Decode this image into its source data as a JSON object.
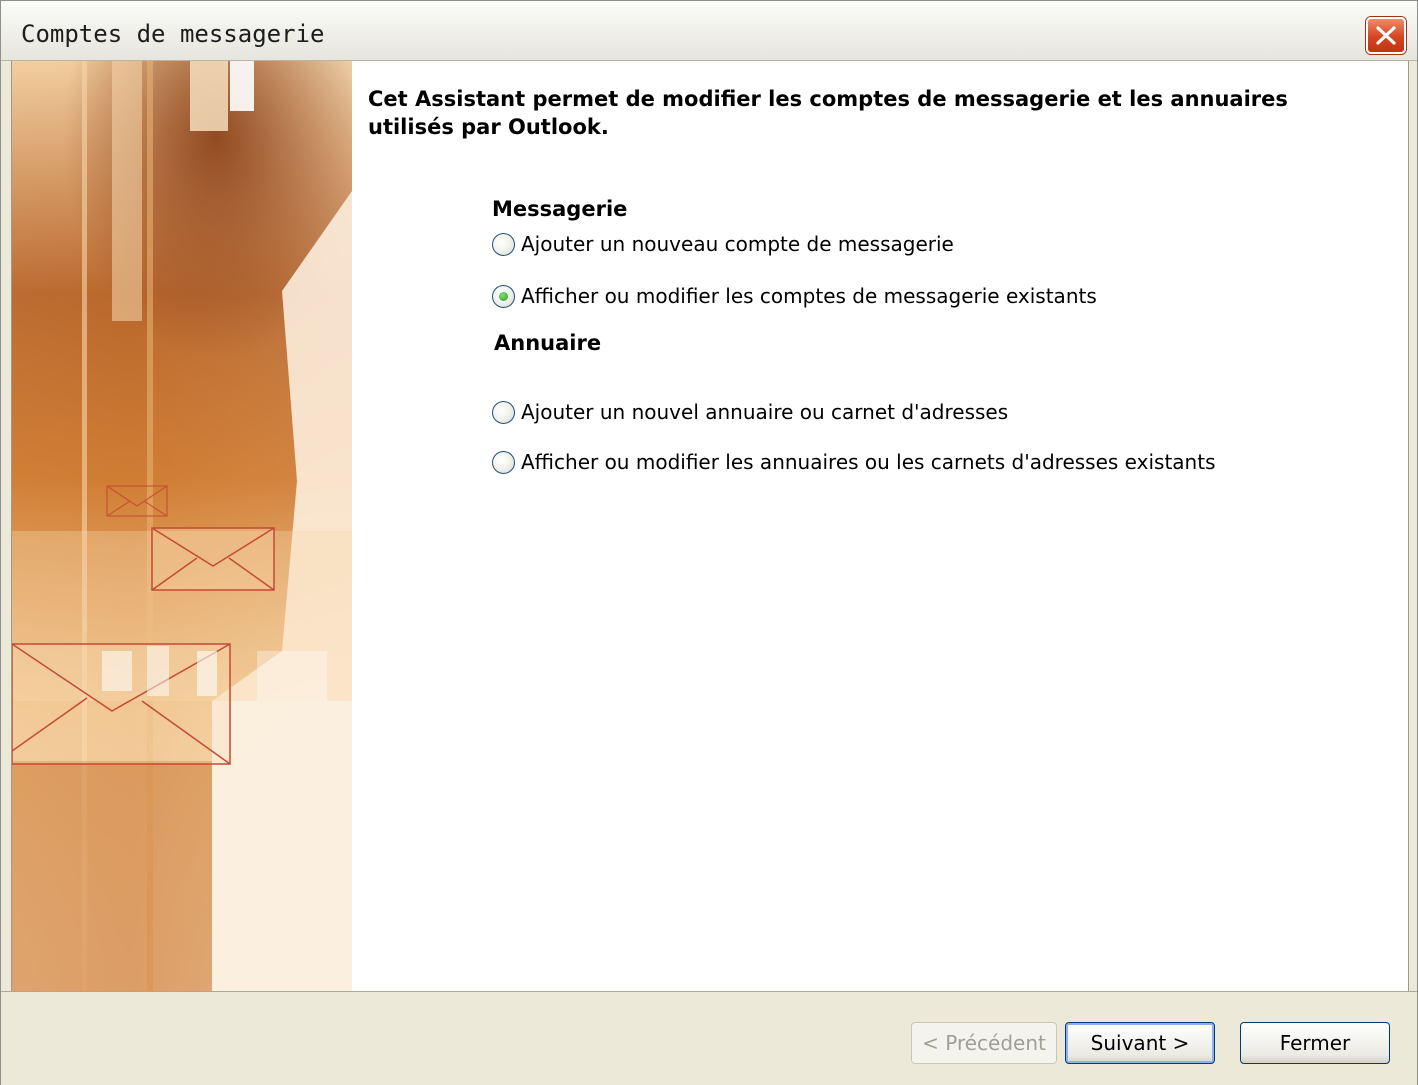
{
  "window": {
    "title": "Comptes de messagerie"
  },
  "intro": "Cet Assistant permet de modifier les comptes de messagerie et les annuaires utilisés par Outlook.",
  "sections": {
    "messagerie": {
      "heading": "Messagerie",
      "options": [
        {
          "label": "Ajouter un nouveau compte de messagerie",
          "checked": false
        },
        {
          "label": "Afficher ou modifier les comptes de messagerie existants",
          "checked": true
        }
      ]
    },
    "annuaire": {
      "heading": "Annuaire",
      "options": [
        {
          "label": "Ajouter un nouvel annuaire ou carnet d'adresses",
          "checked": false
        },
        {
          "label": "Afficher ou modifier les annuaires ou les carnets d'adresses existants",
          "checked": false
        }
      ]
    }
  },
  "buttons": {
    "previous": "< Précédent",
    "next": "Suivant >",
    "close": "Fermer"
  },
  "colors": {
    "accent_orange": "#c9772f",
    "close_red": "#d54520",
    "radio_selected": "#21a121"
  },
  "icons": [
    "close-icon",
    "envelope-icon"
  ]
}
